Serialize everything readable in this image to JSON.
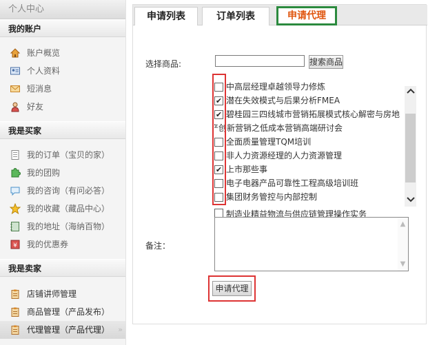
{
  "sidebar": {
    "title": "个人中心",
    "sections": [
      {
        "title": "我的账户",
        "items": [
          {
            "label": "账户概览",
            "icon": "house-icon"
          },
          {
            "label": "个人资料",
            "icon": "id-card-icon"
          },
          {
            "label": "短消息",
            "icon": "envelope-icon"
          },
          {
            "label": "好友",
            "icon": "user-icon"
          }
        ]
      },
      {
        "title": "我是买家",
        "items": [
          {
            "label": "我的订单（宝贝的家）",
            "icon": "document-icon"
          },
          {
            "label": "我的团购",
            "icon": "puzzle-icon"
          },
          {
            "label": "我的咨询（有问必答）",
            "icon": "chat-icon"
          },
          {
            "label": "我的收藏（藏品中心）",
            "icon": "star-icon"
          },
          {
            "label": "我的地址（海纳百物）",
            "icon": "address-book-icon"
          },
          {
            "label": "我的优惠券",
            "icon": "coupon-icon"
          }
        ]
      },
      {
        "title": "我是卖家",
        "items": [
          {
            "label": "店铺讲师管理",
            "icon": "clipboard-icon"
          },
          {
            "label": "商品管理（产品发布）",
            "icon": "clipboard-icon"
          },
          {
            "label": "代理管理（产品代理）",
            "icon": "clipboard-icon",
            "active": true
          }
        ]
      }
    ]
  },
  "tabs": [
    {
      "label": "申请列表"
    },
    {
      "label": "订单列表"
    },
    {
      "label": "申请代理",
      "active": true
    }
  ],
  "form": {
    "select_label": "选择商品:",
    "search_value": "",
    "search_button": "搜索商品",
    "remark_label": "备注：",
    "remark_value": "",
    "apply_button": "申请代理"
  },
  "products": [
    {
      "label": "中高层经理卓越领导力修炼",
      "checked": false
    },
    {
      "label": "潜在失效模式与后果分析FMEA",
      "checked": true
    },
    {
      "label": "碧桂园三四线城市营销拓展模式核心解密与房地",
      "checked": true
    },
    {
      "label": "产创新营销之低成本营销高端研讨会",
      "continuation": true
    },
    {
      "label": "全面质量管理TQM培训",
      "checked": false
    },
    {
      "label": "非人力资源经理的人力资源管理",
      "checked": false
    },
    {
      "label": "上市那些事",
      "checked": true
    },
    {
      "label": "电子电器产品可靠性工程高级培训班",
      "checked": false
    },
    {
      "label": "集团财务管控与内部控制",
      "checked": false
    }
  ],
  "products_extra": {
    "label": "制造业精益物流与供应链管理操作实务",
    "checked": false
  },
  "colors": {
    "accent_tab_text": "#e0560f",
    "highlight_green": "#2b8a3e",
    "highlight_red": "#dd3333"
  }
}
